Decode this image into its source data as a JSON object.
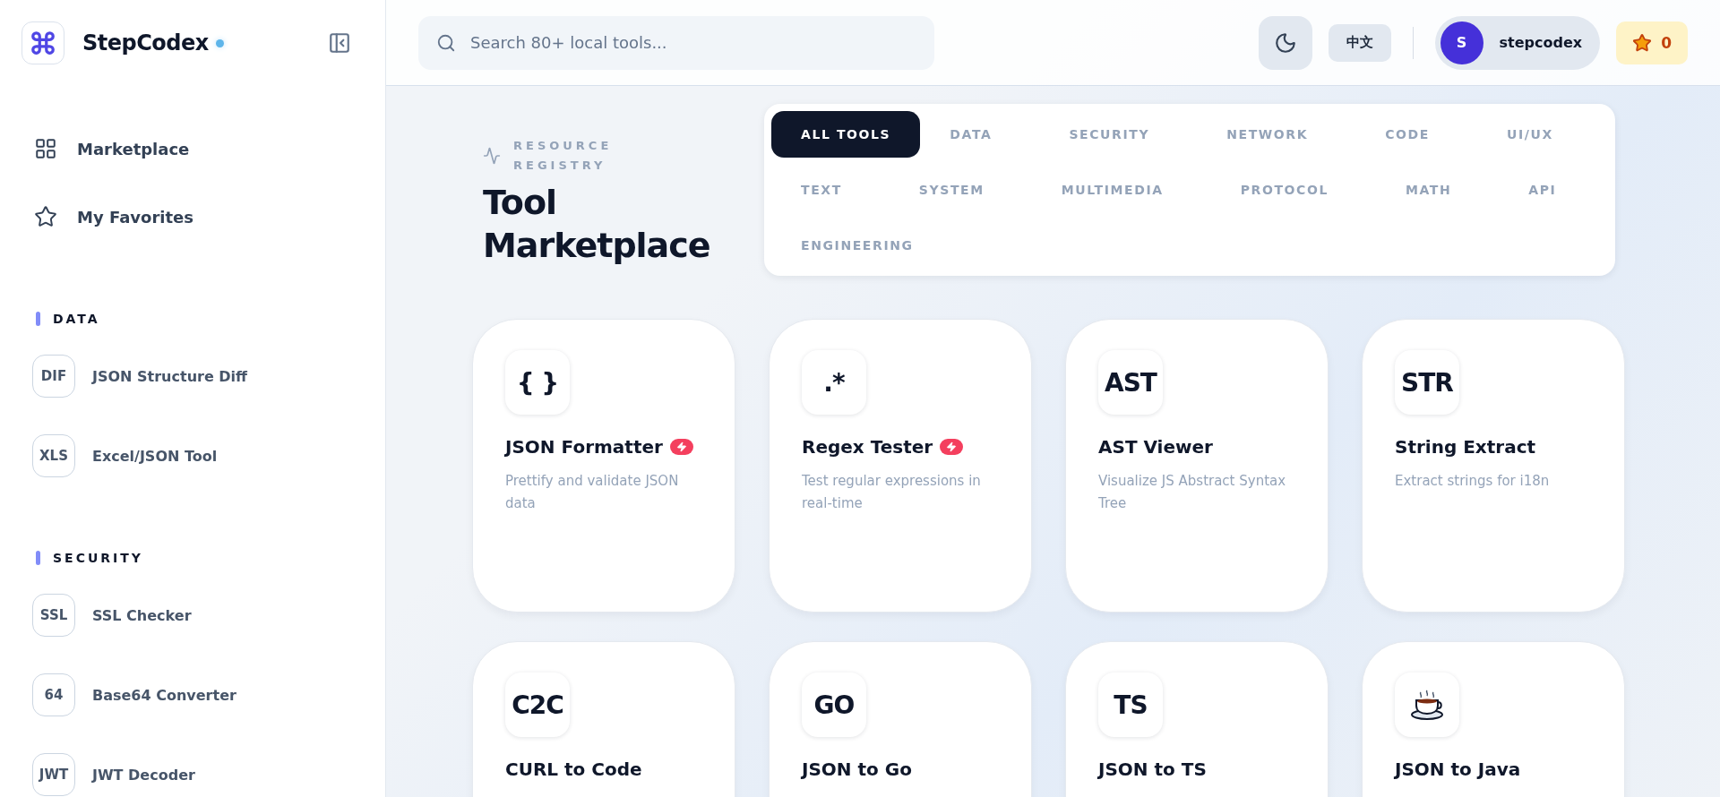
{
  "sidebar": {
    "brand": "StepCodex",
    "nav": [
      {
        "label": "Marketplace",
        "kind": "grid"
      },
      {
        "label": "My Favorites",
        "kind": "star"
      }
    ],
    "sections": [
      {
        "title": "DATA",
        "items": [
          {
            "badge": "DIF",
            "label": "JSON Structure Diff"
          },
          {
            "badge": "XLS",
            "label": "Excel/JSON Tool"
          }
        ]
      },
      {
        "title": "SECURITY",
        "items": [
          {
            "badge": "SSL",
            "label": "SSL Checker"
          },
          {
            "badge": "64",
            "label": "Base64 Converter"
          },
          {
            "badge": "JWT",
            "label": "JWT Decoder"
          }
        ]
      }
    ]
  },
  "header": {
    "search": {
      "placeholder": "Search 80+ local tools..."
    },
    "language": "中文",
    "user": {
      "initial": "S",
      "name": "stepcodex"
    },
    "favorites_count": "0"
  },
  "hero": {
    "eyebrow": "RESOURCE REGISTRY",
    "title": "Tool Marketplace"
  },
  "tabs": [
    {
      "label": "ALL TOOLS",
      "selected": true
    },
    {
      "label": "DATA",
      "selected": false
    },
    {
      "label": "SECURITY",
      "selected": false
    },
    {
      "label": "NETWORK",
      "selected": false
    },
    {
      "label": "CODE",
      "selected": false
    },
    {
      "label": "UI/UX",
      "selected": false
    },
    {
      "label": "TEXT",
      "selected": false
    },
    {
      "label": "SYSTEM",
      "selected": false
    },
    {
      "label": "MULTIMEDIA",
      "selected": false
    },
    {
      "label": "PROTOCOL",
      "selected": false
    },
    {
      "label": "MATH",
      "selected": false
    },
    {
      "label": "API",
      "selected": false
    },
    {
      "label": "ENGINEERING",
      "selected": false
    }
  ],
  "cards": [
    {
      "kind": "text",
      "icon": "{ }",
      "title": "JSON Formatter",
      "featured": true,
      "description": "Prettify and validate JSON data"
    },
    {
      "kind": "text",
      "icon": ".*",
      "title": "Regex Tester",
      "featured": true,
      "description": "Test regular expressions in real-time"
    },
    {
      "kind": "text",
      "icon": "AST",
      "title": "AST Viewer",
      "featured": false,
      "description": "Visualize JS Abstract Syntax Tree"
    },
    {
      "kind": "text",
      "icon": "STR",
      "title": "String Extract",
      "featured": false,
      "description": "Extract strings for i18n"
    },
    {
      "kind": "text",
      "icon": "C2C",
      "title": "CURL to Code",
      "featured": false
    },
    {
      "kind": "text",
      "icon": "GO",
      "title": "JSON to Go",
      "featured": false
    },
    {
      "kind": "text",
      "icon": "TS",
      "title": "JSON to TS",
      "featured": false
    },
    {
      "kind": "cup",
      "title": "JSON to Java",
      "featured": false
    }
  ]
}
